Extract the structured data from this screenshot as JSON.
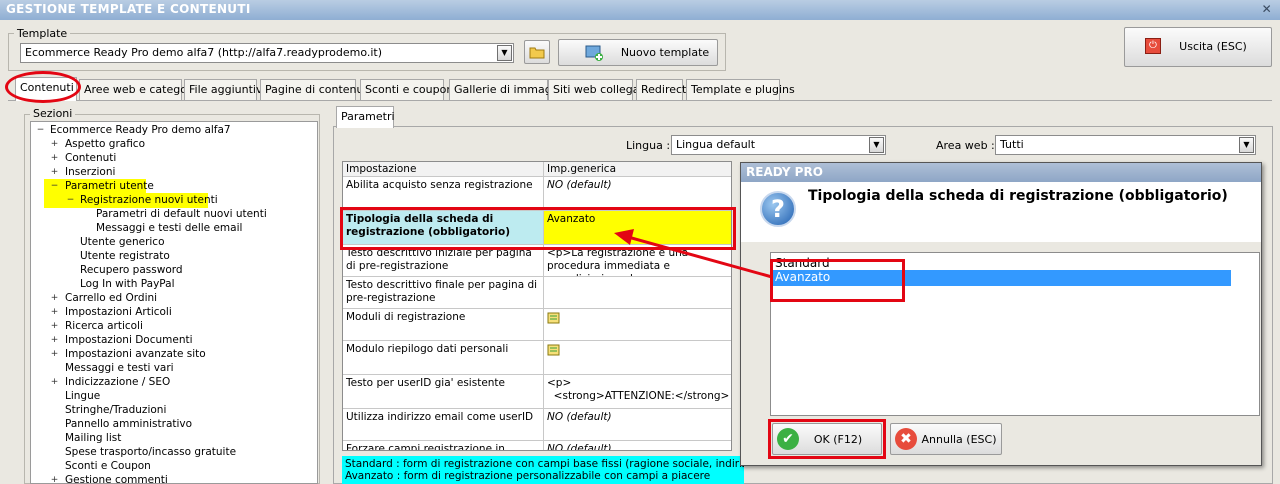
{
  "window": {
    "title": "GESTIONE TEMPLATE E CONTENUTI",
    "close_glyph": "✕"
  },
  "template": {
    "label": "Template",
    "selected": "Ecommerce Ready Pro demo alfa7 (http://alfa7.readyprodemo.it)",
    "new_button": "Nuovo template"
  },
  "exit_button": "Uscita (ESC)",
  "tabs": [
    "Contenuti",
    "Aree web e categorie",
    "File aggiuntivi",
    "Pagine di contenuti",
    "Sconti e coupon",
    "Gallerie di immagini",
    "Siti web collegati",
    "Redirect",
    "Template e plugins"
  ],
  "sections": {
    "label": "Sezioni",
    "items": [
      {
        "text": "Ecommerce Ready Pro demo alfa7",
        "toggle": "−"
      },
      {
        "text": "Aspetto grafico",
        "toggle": "+"
      },
      {
        "text": "Contenuti",
        "toggle": "+"
      },
      {
        "text": "Inserzioni",
        "toggle": "+"
      },
      {
        "text": "Parametri utente",
        "toggle": "−"
      },
      {
        "text": "Registrazione nuovi utenti",
        "toggle": "−"
      },
      {
        "text": "Parametri di default nuovi utenti",
        "toggle": ""
      },
      {
        "text": "Messaggi e testi delle email",
        "toggle": ""
      },
      {
        "text": "Utente generico",
        "toggle": ""
      },
      {
        "text": "Utente registrato",
        "toggle": ""
      },
      {
        "text": "Recupero password",
        "toggle": ""
      },
      {
        "text": "Log In with PayPal",
        "toggle": ""
      },
      {
        "text": "Carrello ed Ordini",
        "toggle": "+"
      },
      {
        "text": "Impostazioni Articoli",
        "toggle": "+"
      },
      {
        "text": "Ricerca articoli",
        "toggle": "+"
      },
      {
        "text": "Impostazioni Documenti",
        "toggle": "+"
      },
      {
        "text": "Impostazioni avanzate sito",
        "toggle": "+"
      },
      {
        "text": "Messaggi e testi vari",
        "toggle": ""
      },
      {
        "text": "Indicizzazione / SEO",
        "toggle": "+"
      },
      {
        "text": "Lingue",
        "toggle": ""
      },
      {
        "text": "Stringhe/Traduzioni",
        "toggle": ""
      },
      {
        "text": "Pannello amministrativo",
        "toggle": ""
      },
      {
        "text": "Mailing list",
        "toggle": ""
      },
      {
        "text": "Spese trasporto/incasso gratuite",
        "toggle": ""
      },
      {
        "text": "Sconti e Coupon",
        "toggle": ""
      },
      {
        "text": "Gestione commenti",
        "toggle": "+"
      }
    ]
  },
  "params_tab": "Parametri",
  "filters": {
    "lingua_label": "Lingua :",
    "lingua_value": "Lingua default",
    "area_label": "Area web :",
    "area_value": "Tutti"
  },
  "grid": {
    "headers": [
      "Impostazione",
      "Imp.generica"
    ],
    "rows": [
      {
        "name": "Abilita acquisto senza registrazione",
        "value": "NO (default)"
      },
      {
        "name": "Tipologia della scheda di registrazione (obbligatorio)",
        "value": "Avanzato"
      },
      {
        "name": "Testo descrittivo iniziale per pagina di pre-registrazione",
        "value": "<p>La registrazione è una procedura immediata e semplicissima che"
      },
      {
        "name": "Testo descrittivo finale per pagina di pre-registrazione",
        "value": ""
      },
      {
        "name": "Moduli di registrazione",
        "value": ""
      },
      {
        "name": "Modulo riepilogo dati personali",
        "value": ""
      },
      {
        "name": "Testo per userID gia' esistente",
        "value": "<p>\n  <strong>ATTENZIONE:</strong>"
      },
      {
        "name": "Utilizza indirizzo email come userID",
        "value": "NO (default)"
      },
      {
        "name": "Forzare campi registrazione in maiuscolo",
        "value": "NO (default)"
      }
    ]
  },
  "help_text": {
    "line1": "Standard : form di registrazione con campi base fissi (ragione sociale, indirizzo, telefono,",
    "line2": "Avanzato : form di registrazione personalizzabile con campi a piacere"
  },
  "dialog": {
    "title": "READY PRO",
    "question": "Tipologia della scheda di registrazione (obbligatorio)",
    "question_glyph": "?",
    "options": [
      "Standard",
      "Avanzato"
    ],
    "selected_index": 1,
    "ok_button": "OK (F12)",
    "cancel_button": "Annulla (ESC)"
  },
  "colors": {
    "highlight": "#ffff00",
    "selection": "#3399ff",
    "annotation": "#e30613",
    "help_bg": "#00ffff"
  }
}
